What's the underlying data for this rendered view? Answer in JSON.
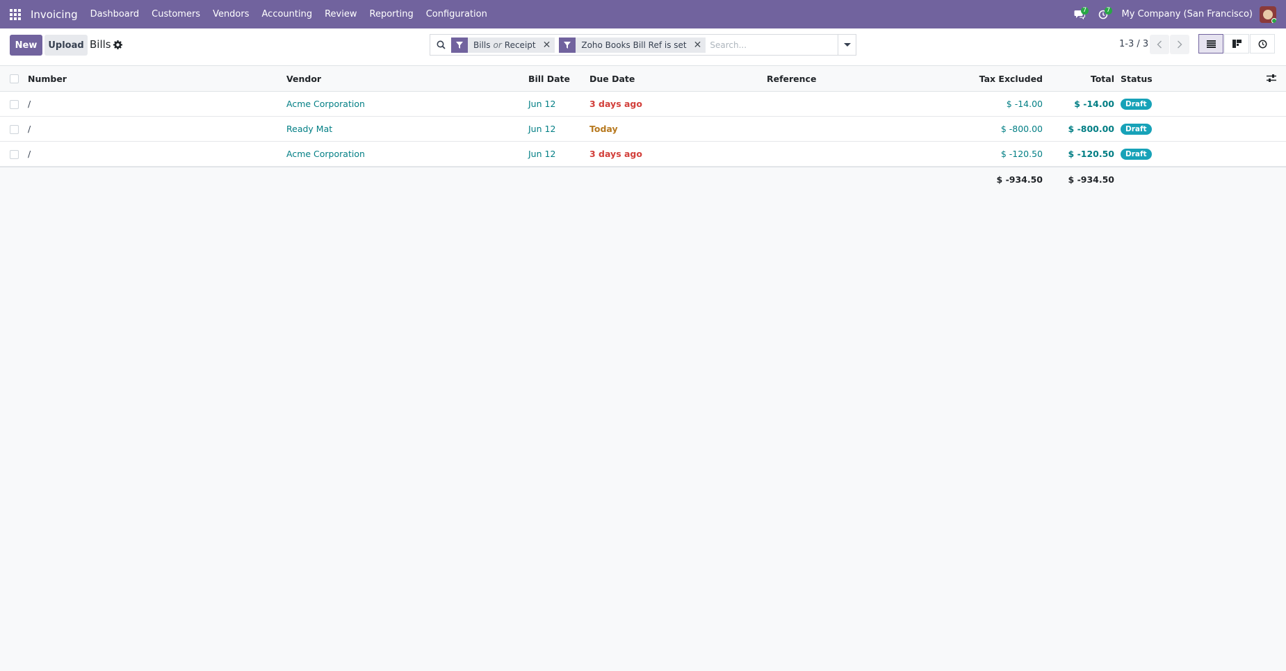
{
  "navbar": {
    "app_name": "Invoicing",
    "menu": [
      "Dashboard",
      "Customers",
      "Vendors",
      "Accounting",
      "Review",
      "Reporting",
      "Configuration"
    ],
    "messages_count": "7",
    "activities_count": "7",
    "company": "My Company (San Francisco)",
    "accent_color": "#71639e"
  },
  "control_panel": {
    "new_label": "New",
    "upload_label": "Upload",
    "breadcrumb": "Bills",
    "search": {
      "facet1_a": "Bills",
      "facet1_or": "or",
      "facet1_b": "Receipt",
      "facet2": "Zoho Books Bill Ref is set",
      "placeholder": "Search..."
    },
    "pager": "1-3 / 3"
  },
  "table": {
    "columns": {
      "number": "Number",
      "vendor": "Vendor",
      "bill_date": "Bill Date",
      "due_date": "Due Date",
      "reference": "Reference",
      "tax_excluded": "Tax Excluded",
      "total": "Total",
      "status": "Status"
    },
    "rows": [
      {
        "number": "/",
        "vendor": "Acme Corporation",
        "bill_date": "Jun 12",
        "due_date": "3 days ago",
        "reference": "",
        "tax_excluded": "$ -14.00",
        "total": "$ -14.00",
        "status": "Draft"
      },
      {
        "number": "/",
        "vendor": "Ready Mat",
        "bill_date": "Jun 12",
        "due_date": "Today",
        "reference": "",
        "tax_excluded": "$ -800.00",
        "total": "$ -800.00",
        "status": "Draft"
      },
      {
        "number": "/",
        "vendor": "Acme Corporation",
        "bill_date": "Jun 12",
        "due_date": "3 days ago",
        "reference": "",
        "tax_excluded": "$ -120.50",
        "total": "$ -120.50",
        "status": "Draft"
      }
    ],
    "totals": {
      "tax_excluded": "$ -934.50",
      "total": "$ -934.50"
    }
  }
}
